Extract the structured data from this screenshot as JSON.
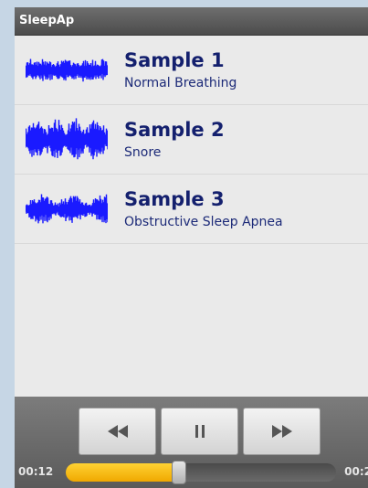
{
  "app": {
    "title": "SleepAp"
  },
  "samples": [
    {
      "title": "Sample 1",
      "subtitle": "Normal Breathing",
      "icon": "waveform-icon"
    },
    {
      "title": "Sample 2",
      "subtitle": "Snore",
      "icon": "waveform-icon"
    },
    {
      "title": "Sample 3",
      "subtitle": "Obstructive Sleep Apnea",
      "icon": "waveform-icon"
    }
  ],
  "player": {
    "current_time": "00:12",
    "total_time": "00:2",
    "progress": 0.42,
    "buttons": [
      "rewind-icon",
      "pause-icon",
      "fast-forward-icon"
    ]
  },
  "colors": {
    "title_text": "#14206e",
    "waveform": "#1a1aff",
    "progress_fill": "#f5b800",
    "title_bar": "#555555"
  }
}
